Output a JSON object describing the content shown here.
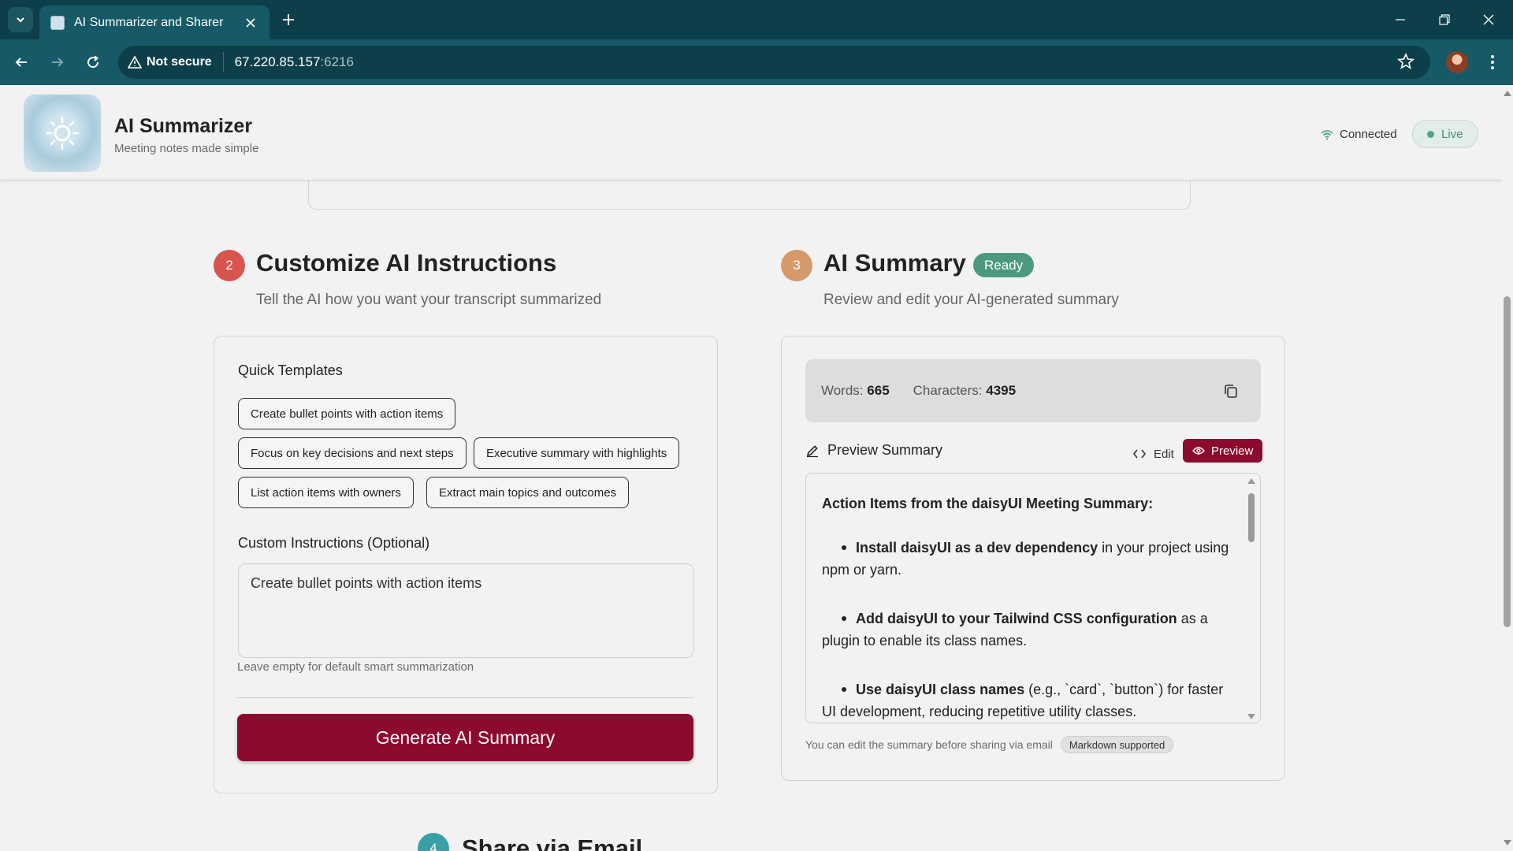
{
  "browser": {
    "tab_title": "AI Summarizer and Sharer",
    "security_label": "Not secure",
    "url_host": "67.220.85.157",
    "url_port": ":6216"
  },
  "header": {
    "title": "AI Summarizer",
    "subtitle": "Meeting notes made simple",
    "connection_status": "Connected",
    "live_label": "Live"
  },
  "customize": {
    "step": "2",
    "title": "Customize AI Instructions",
    "description": "Tell the AI how you want your transcript summarized",
    "templates_label": "Quick Templates",
    "templates": [
      "Create bullet points with action items",
      "Focus on key decisions and next steps",
      "Executive summary with highlights",
      "List action items with owners",
      "Extract main topics and outcomes"
    ],
    "custom_label": "Custom Instructions (Optional)",
    "custom_value": "Create bullet points with action items",
    "hint": "Leave empty for default smart summarization",
    "generate_label": "Generate AI Summary"
  },
  "summary": {
    "step": "3",
    "title": "AI Summary",
    "status_badge": "Ready",
    "description": "Review and edit your AI-generated summary",
    "words_label": "Words:",
    "words_value": "665",
    "chars_label": "Characters:",
    "chars_value": "4395",
    "preview_label": "Preview Summary",
    "edit_label": "Edit",
    "preview_toggle_label": "Preview",
    "content_heading": "Action Items from the daisyUI Meeting Summary:",
    "items": [
      {
        "bold": "Install daisyUI as a dev dependency",
        "rest": " in your project using npm or yarn."
      },
      {
        "bold": "Add daisyUI to your Tailwind CSS configuration",
        "rest": " as a plugin to enable its class names."
      },
      {
        "bold": "Use daisyUI class names",
        "rest": " (e.g., `card`, `button`) for faster UI development, reducing repetitive utility classes."
      }
    ],
    "footer_note": "You can edit the summary before sharing via email",
    "markdown_badge": "Markdown supported"
  },
  "next_section": {
    "step": "4",
    "title": "Share via Email"
  },
  "colors": {
    "browser_dark": "#0d3f4a",
    "browser_teal": "#155a66",
    "primary": "#8c0a2d",
    "step2": "#d9534f",
    "step3": "#d69a6a",
    "step4": "#3aa0a8",
    "ready": "#4b9a80",
    "live": "#4ea489"
  }
}
